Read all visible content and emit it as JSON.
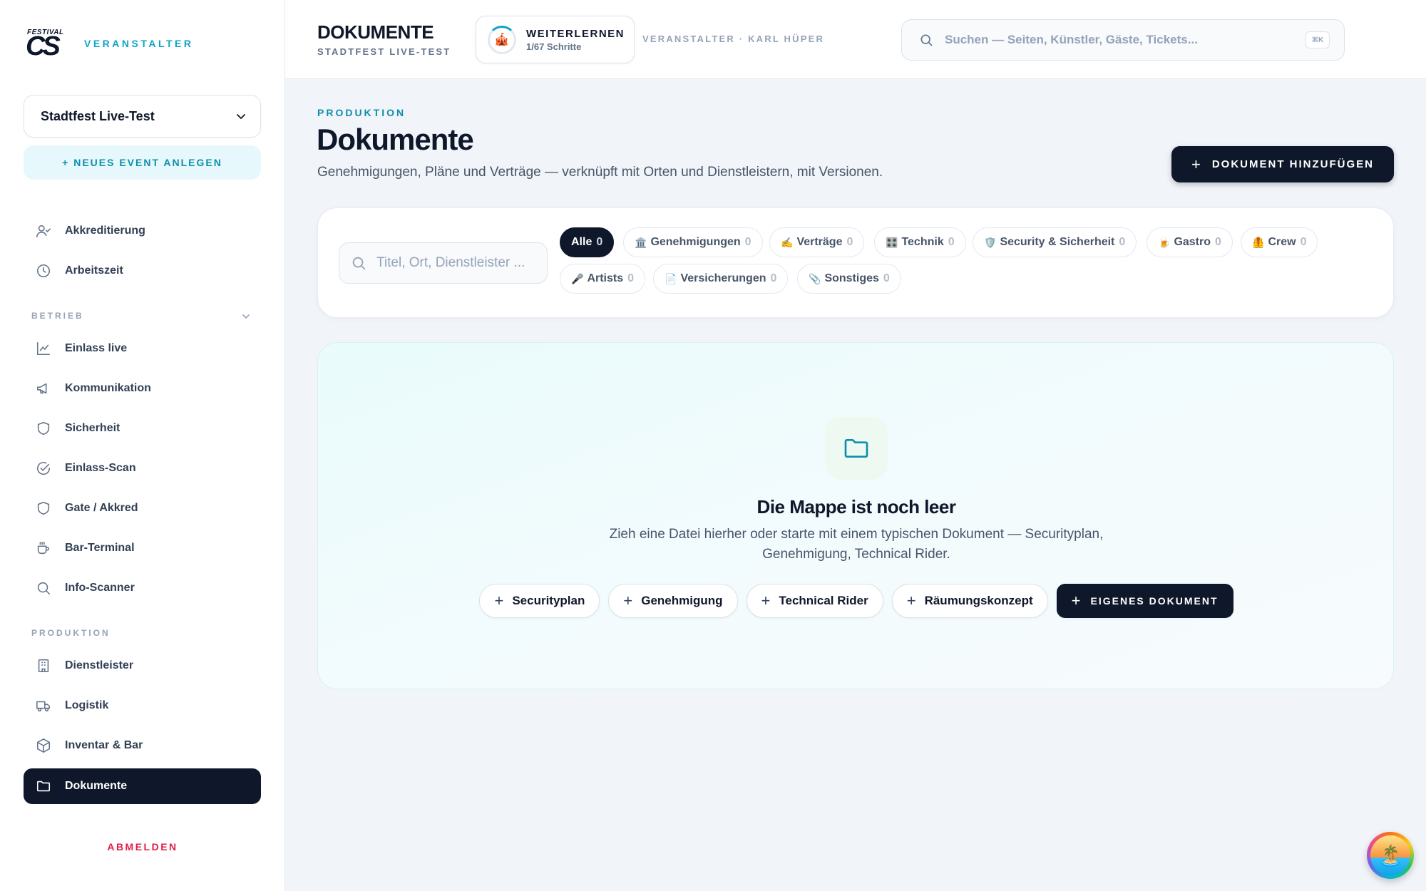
{
  "brand": {
    "logo_top": "FESTIVAL",
    "logo_main": "CS",
    "role": "VERANSTALTER"
  },
  "event_select": {
    "value": "Stadtfest Live-Test"
  },
  "new_event_label": "+ NEUES EVENT ANLEGEN",
  "nav": {
    "top": [
      {
        "label": "Akkreditierung",
        "icon": "user-check-icon"
      },
      {
        "label": "Arbeitszeit",
        "icon": "clock-icon"
      }
    ],
    "betrieb_label": "BETRIEB",
    "betrieb": [
      {
        "label": "Einlass live",
        "icon": "line-chart-icon"
      },
      {
        "label": "Kommunikation",
        "icon": "megaphone-icon"
      },
      {
        "label": "Sicherheit",
        "icon": "shield-icon"
      },
      {
        "label": "Einlass-Scan",
        "icon": "check-circle-icon"
      },
      {
        "label": "Gate / Akkred",
        "icon": "shield-icon"
      },
      {
        "label": "Bar-Terminal",
        "icon": "coffee-icon"
      },
      {
        "label": "Info-Scanner",
        "icon": "search-icon"
      }
    ],
    "produktion_label": "PRODUKTION",
    "produktion": [
      {
        "label": "Dienstleister",
        "icon": "building-icon"
      },
      {
        "label": "Logistik",
        "icon": "truck-icon"
      },
      {
        "label": "Inventar & Bar",
        "icon": "box-icon"
      },
      {
        "label": "Dokumente",
        "icon": "folder-icon",
        "active": true
      }
    ],
    "logout": "ABMELDEN"
  },
  "header": {
    "title": "DOKUMENTE",
    "subtitle": "STADTFEST LIVE-TEST",
    "learn_title": "WEITERLERNEN",
    "learn_progress": "1/67 Schritte",
    "learn_emoji": "🎪",
    "user_line": "VERANSTALTER · KARL HÜPER",
    "search_placeholder": "Suchen — Seiten, Künstler, Gäste, Tickets...",
    "search_shortcut": "⌘K"
  },
  "main": {
    "eyebrow": "PRODUKTION",
    "title": "Dokumente",
    "subtitle": "Genehmigungen, Pläne und Verträge — verknüpft mit Orten und Dienstleistern, mit Versionen.",
    "add_button": "DOKUMENT HINZUFÜGEN"
  },
  "filters": {
    "search_placeholder": "Titel, Ort, Dienstleister ...",
    "chips": [
      {
        "emoji": "",
        "label": "Alle",
        "count": "0",
        "active": true
      },
      {
        "emoji": "🏛️",
        "label": "Genehmigungen",
        "count": "0"
      },
      {
        "emoji": "✍️",
        "label": "Verträge",
        "count": "0"
      },
      {
        "emoji": "🎛️",
        "label": "Technik",
        "count": "0"
      },
      {
        "emoji": "🛡️",
        "label": "Security & Sicherheit",
        "count": "0"
      },
      {
        "emoji": "🍺",
        "label": "Gastro",
        "count": "0"
      },
      {
        "emoji": "🦺",
        "label": "Crew",
        "count": "0"
      },
      {
        "emoji": "🎤",
        "label": "Artists",
        "count": "0"
      },
      {
        "emoji": "📄",
        "label": "Versicherungen",
        "count": "0"
      },
      {
        "emoji": "📎",
        "label": "Sonstiges",
        "count": "0"
      }
    ]
  },
  "empty_state": {
    "title": "Die Mappe ist noch leer",
    "text": "Zieh eine Datei hierher oder starte mit einem typischen Dokument — Securityplan, Genehmigung, Technical Rider.",
    "templates": [
      "Securityplan",
      "Genehmigung",
      "Technical Rider",
      "Räumungskonzept"
    ],
    "own_button": "EIGENES DOKUMENT"
  },
  "fab_emoji": "🏝️",
  "colors": {
    "accent": "#0ea5c6",
    "dark": "#0f172a",
    "danger": "#e11d48"
  }
}
